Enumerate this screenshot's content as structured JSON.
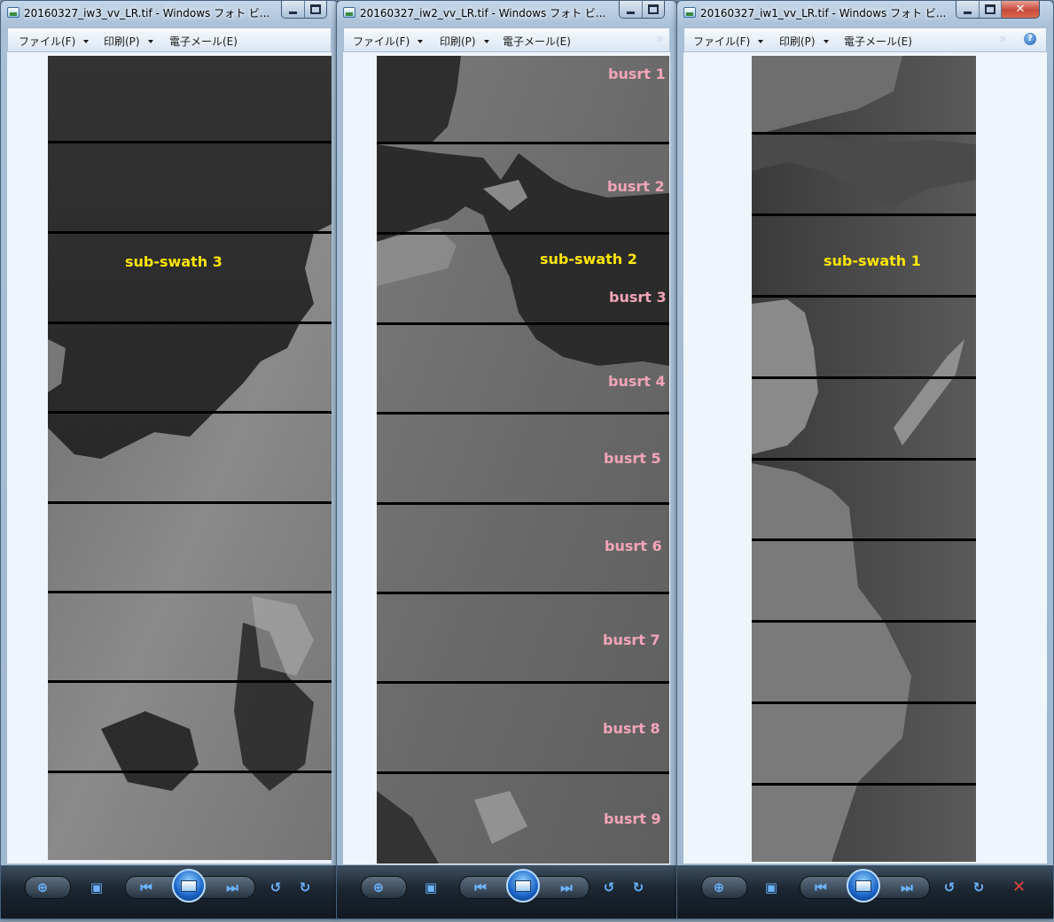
{
  "windows": [
    {
      "id": "iw3",
      "title": "20160327_iw3_vv_LR.tif - Windows フォト ビ...",
      "menu": [
        "ファイル(F)",
        "印刷(P)",
        "電子メール(E)"
      ],
      "swath_label": "sub-swath 3",
      "burst_labels": []
    },
    {
      "id": "iw2",
      "title": "20160327_iw2_vv_LR.tif - Windows フォト ビ...",
      "menu": [
        "ファイル(F)",
        "印刷(P)",
        "電子メール(E)"
      ],
      "swath_label": "sub-swath 2",
      "burst_labels": [
        "busrt 1",
        "busrt 2",
        "busrt 3",
        "busrt 4",
        "busrt 5",
        "busrt 6",
        "busrt 7",
        "busrt 8",
        "busrt 9"
      ]
    },
    {
      "id": "iw1",
      "title": "20160327_iw1_vv_LR.tif - Windows フォト ビ...",
      "menu": [
        "ファイル(F)",
        "印刷(P)",
        "電子メール(E)"
      ],
      "swath_label": "sub-swath 1",
      "burst_labels": []
    }
  ],
  "window_controls": {
    "minimize": "minimize-icon",
    "maximize": "maximize-icon",
    "close": "✕"
  },
  "toolbar_icons": [
    "zoom-icon",
    "actual-size-icon",
    "previous-icon",
    "slideshow-icon",
    "next-icon",
    "rotate-left-icon",
    "rotate-right-icon",
    "delete-icon"
  ],
  "help_icon": "?",
  "overflow_chevron": "»",
  "colors": {
    "swath_label": "#ffe600",
    "burst_label": "#f3a5b8",
    "burst_line": "#000000"
  }
}
